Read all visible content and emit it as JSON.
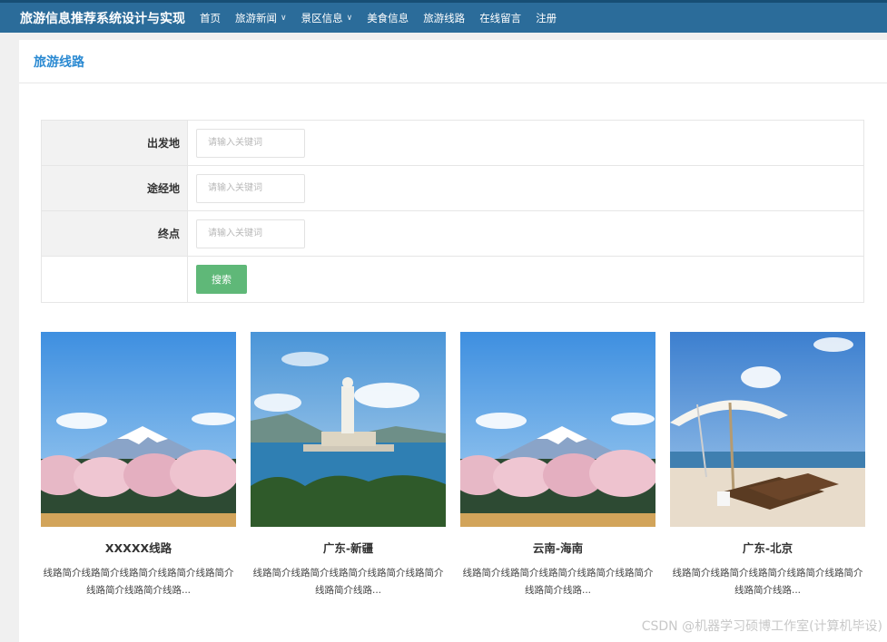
{
  "app": {
    "title": "旅游信息推荐系统设计与实现"
  },
  "nav": {
    "items": [
      {
        "label": "首页",
        "dropdown": false
      },
      {
        "label": "旅游新闻",
        "dropdown": true
      },
      {
        "label": "景区信息",
        "dropdown": true
      },
      {
        "label": "美食信息",
        "dropdown": false
      },
      {
        "label": "旅游线路",
        "dropdown": false
      },
      {
        "label": "在线留言",
        "dropdown": false
      },
      {
        "label": "注册",
        "dropdown": false
      }
    ],
    "chevron_icon": "chevron-down-icon"
  },
  "page": {
    "title": "旅游线路"
  },
  "search": {
    "fields": [
      {
        "label": "出发地",
        "placeholder": "请输入关键词",
        "value": ""
      },
      {
        "label": "途经地",
        "placeholder": "请输入关键词",
        "value": ""
      },
      {
        "label": "终点",
        "placeholder": "请输入关键词",
        "value": ""
      }
    ],
    "button_label": "搜索"
  },
  "routes": [
    {
      "title": "XXXXX线路",
      "description": "线路简介线路简介线路简介线路简介线路简介线路简介线路简介线路...",
      "image": "mount-fuji-cherry-blossoms"
    },
    {
      "title": "广东-新疆",
      "description": "线路简介线路简介线路简介线路简介线路简介线路简介线路...",
      "image": "guanyin-statue-sea"
    },
    {
      "title": "云南-海南",
      "description": "线路简介线路简介线路简介线路简介线路简介线路简介线路...",
      "image": "mount-fuji-cherry-blossoms"
    },
    {
      "title": "广东-北京",
      "description": "线路简介线路简介线路简介线路简介线路简介线路简介线路...",
      "image": "beach-umbrella-loungers"
    }
  ],
  "watermark": "CSDN @机器学习硕博工作室(计算机毕设)",
  "colors": {
    "nav_bg": "#2b6c9a",
    "title_blue": "#2b8ad2",
    "button_green": "#5fb878"
  }
}
